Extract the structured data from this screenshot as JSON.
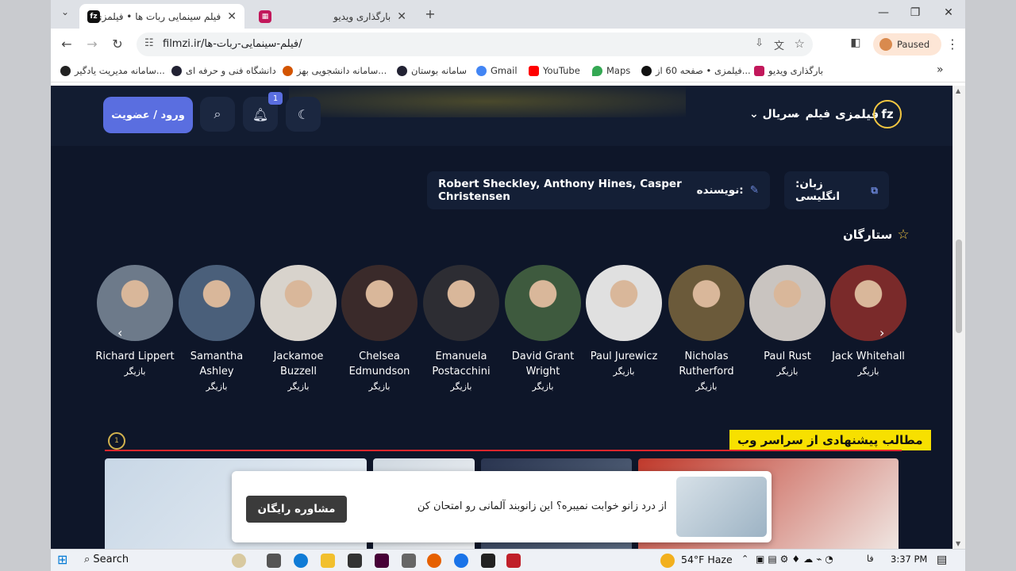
{
  "tabs": [
    {
      "title": "فیلم سینمایی ربات ها • فیلمزی",
      "favicon": "fz"
    },
    {
      "title": "بارگذاری ویدیو",
      "favicon": "grid"
    }
  ],
  "new_tab": "+",
  "url": "filmzi.ir/فیلم-سینمایی-ربات-ها/",
  "profile": "Paused",
  "bookmarks": [
    "بارگذاری ویدیو",
    "فیلمزی • صفحه 60 از...",
    "Maps",
    "YouTube",
    "Gmail",
    "سامانه بوستان",
    "سامانه دانشجویی بهز...",
    "دانشگاه فنی و حرفه ای",
    "سامانه مدیریت یادگیر..."
  ],
  "site": {
    "logo_text": "fz",
    "name": "فیلمزی",
    "nav": {
      "film": "فیلم",
      "serial": "سریال"
    },
    "login": "ورود / عضویت",
    "notif_count": "1"
  },
  "info": {
    "language_label": "زبان: انگلیسی",
    "writer_label": "نویسنده:",
    "writer_value": "Robert Sheckley, Anthony Hines, Casper Christensen"
  },
  "stars_title": "ستارگان",
  "cast": [
    {
      "name": "Jack Whitehall",
      "role": "بازیگر",
      "color": "#7a2a2a"
    },
    {
      "name": "Paul Rust",
      "role": "بازیگر",
      "color": "#c9c4c0"
    },
    {
      "name": "Nicholas Rutherford",
      "role": "بازیگر",
      "color": "#6b5a3a"
    },
    {
      "name": "Paul Jurewicz",
      "role": "بازیگر",
      "color": "#e0e0e0"
    },
    {
      "name": "David Grant Wright",
      "role": "بازیگر",
      "color": "#3e5a3e"
    },
    {
      "name": "Emanuela Postacchini",
      "role": "بازیگر",
      "color": "#2d2d33"
    },
    {
      "name": "Chelsea Edmundson",
      "role": "بازیگر",
      "color": "#3a2a2a"
    },
    {
      "name": "Jackamoe Buzzell",
      "role": "بازیگر",
      "color": "#d8d3cc"
    },
    {
      "name": "Samantha Ashley",
      "role": "بازیگر",
      "color": "#4a5f7a"
    },
    {
      "name": "Richard Lippert",
      "role": "بازیگر",
      "color": "#6d7a8a"
    }
  ],
  "suggest_title": "مطالب پیشنهادی از سراسر وب",
  "badge": "1",
  "ad": {
    "button": "مشاوره رایگان",
    "text": "از درد زانو خوابت نمیبره؟ این زانوبند آلمانی رو امتحان کن"
  },
  "taskbar": {
    "search": "Search",
    "weather": "54°F  Haze",
    "lang": "فا",
    "time": "3:37 PM"
  }
}
